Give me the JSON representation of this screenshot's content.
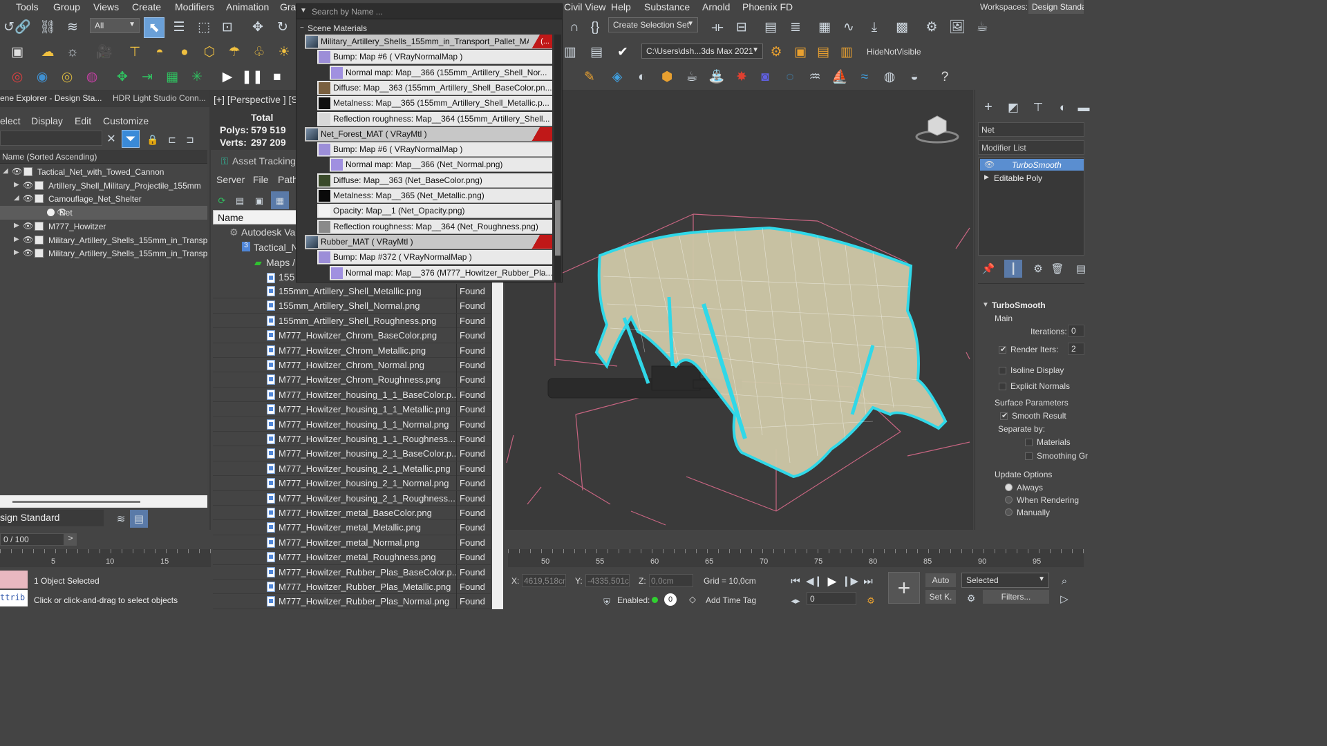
{
  "menu": [
    "Tools",
    "Group",
    "Views",
    "Create",
    "Modifiers",
    "Animation",
    "Gra",
    "Civil View",
    "Help",
    "Substance",
    "Arnold",
    "Phoenix FD"
  ],
  "workspaces_label": "Workspaces:",
  "workspaces_value": "Design Standa",
  "toolbar": {
    "filter_value": "All",
    "create_selection_set": "Create Selection Set",
    "path_value": "C:\\Users\\dsh...3ds Max 2021",
    "hide_not_visible": "HideNotVisible"
  },
  "scene_explorer": {
    "tab1": "ene Explorer - Design Sta...",
    "tab2": "HDR Light Studio Conn...",
    "menus": [
      "elect",
      "Display",
      "Edit",
      "Customize"
    ],
    "column_header": "Name (Sorted Ascending)",
    "items": [
      {
        "label": "Tactical_Net_with_Towed_Cannon",
        "indent": 0,
        "expander": "open"
      },
      {
        "label": "Artillery_Shell_Military_Projectile_155mm",
        "indent": 1,
        "expander": "closed"
      },
      {
        "label": "Camouflage_Net_Shelter",
        "indent": 1,
        "expander": "open"
      },
      {
        "label": "Net",
        "indent": 2,
        "expander": "none",
        "selected": true
      },
      {
        "label": "M777_Howitzer",
        "indent": 1,
        "expander": "closed"
      },
      {
        "label": "Military_Artillery_Shells_155mm_in_Transpor",
        "indent": 1,
        "expander": "closed"
      },
      {
        "label": "Military_Artillery_Shells_155mm_in_Transpor",
        "indent": 1,
        "expander": "closed"
      }
    ],
    "workspace_value": "sign Standard"
  },
  "viewport": {
    "label": "[+] [Perspective ] [S",
    "stats_title": "Total",
    "polys_label": "Polys:",
    "polys_value": "579 519",
    "verts_label": "Verts:",
    "verts_value": "297 209"
  },
  "asset_tracking": {
    "title": "Asset Tracking",
    "menus": [
      "Server",
      "File",
      "Path"
    ],
    "col_name": "Name",
    "tree": [
      "Autodesk Vau",
      "Tactical_N",
      "Maps /",
      "155"
    ],
    "files": [
      {
        "name": "155mm_Artillery_Shell_Metallic.png",
        "status": "Found"
      },
      {
        "name": "155mm_Artillery_Shell_Normal.png",
        "status": "Found"
      },
      {
        "name": "155mm_Artillery_Shell_Roughness.png",
        "status": "Found"
      },
      {
        "name": "M777_Howitzer_Chrom_BaseColor.png",
        "status": "Found"
      },
      {
        "name": "M777_Howitzer_Chrom_Metallic.png",
        "status": "Found"
      },
      {
        "name": "M777_Howitzer_Chrom_Normal.png",
        "status": "Found"
      },
      {
        "name": "M777_Howitzer_Chrom_Roughness.png",
        "status": "Found"
      },
      {
        "name": "M777_Howitzer_housing_1_1_BaseColor.p...",
        "status": "Found"
      },
      {
        "name": "M777_Howitzer_housing_1_1_Metallic.png",
        "status": "Found"
      },
      {
        "name": "M777_Howitzer_housing_1_1_Normal.png",
        "status": "Found"
      },
      {
        "name": "M777_Howitzer_housing_1_1_Roughness....",
        "status": "Found"
      },
      {
        "name": "M777_Howitzer_housing_2_1_BaseColor.p...",
        "status": "Found"
      },
      {
        "name": "M777_Howitzer_housing_2_1_Metallic.png",
        "status": "Found"
      },
      {
        "name": "M777_Howitzer_housing_2_1_Normal.png",
        "status": "Found"
      },
      {
        "name": "M777_Howitzer_housing_2_1_Roughness....",
        "status": "Found"
      },
      {
        "name": "M777_Howitzer_metal_BaseColor.png",
        "status": "Found"
      },
      {
        "name": "M777_Howitzer_metal_Metallic.png",
        "status": "Found"
      },
      {
        "name": "M777_Howitzer_metal_Normal.png",
        "status": "Found"
      },
      {
        "name": "M777_Howitzer_metal_Roughness.png",
        "status": "Found"
      },
      {
        "name": "M777_Howitzer_Rubber_Plas_BaseColor.p...",
        "status": "Found"
      },
      {
        "name": "M777_Howitzer_Rubber_Plas_Metallic.png",
        "status": "Found"
      },
      {
        "name": "M777_Howitzer_Rubber_Plas_Normal.png",
        "status": "Found"
      }
    ]
  },
  "material_popup": {
    "search_placeholder": "Search by Name ...",
    "section": "Scene Materials",
    "rows": [
      {
        "text": "Military_Artillery_Shells_155mm_in_Transport_Pallet_MAT",
        "indent": 0,
        "kind": "mat",
        "badge": "(..."
      },
      {
        "text": "Bump: Map #6  ( VRayNormalMap )",
        "indent": 1,
        "kind": "map",
        "swatch": "#9c8ed8"
      },
      {
        "text": "Normal map:  Map__366 (155mm_Artillery_Shell_Nor...",
        "indent": 2,
        "kind": "map",
        "swatch": "#a090e0"
      },
      {
        "text": "Diffuse:  Map__363  (155mm_Artillery_Shell_BaseColor.pn...",
        "indent": 1,
        "kind": "map",
        "swatch": "#7a6040"
      },
      {
        "text": "Metalness:  Map__365  (155mm_Artillery_Shell_Metallic.p...",
        "indent": 1,
        "kind": "map",
        "swatch": "#111111"
      },
      {
        "text": "Reflection roughness:  Map__364  (155mm_Artillery_Shell...",
        "indent": 1,
        "kind": "map",
        "swatch": "#d8d8d8"
      },
      {
        "text": "Net_Forest_MAT  ( VRayMtl )",
        "indent": 0,
        "kind": "mat",
        "badge": ""
      },
      {
        "text": "Bump: Map #6  ( VRayNormalMap )",
        "indent": 1,
        "kind": "map",
        "swatch": "#9c8ed8"
      },
      {
        "text": "Normal map:  Map__366 (Net_Normal.png)",
        "indent": 2,
        "kind": "map",
        "swatch": "#a090e0"
      },
      {
        "text": "Diffuse:  Map__363 (Net_BaseColor.png)",
        "indent": 1,
        "kind": "map",
        "swatch": "#3a4a2a"
      },
      {
        "text": "Metalness:  Map__365 (Net_Metallic.png)",
        "indent": 1,
        "kind": "map",
        "swatch": "#0a0a0a"
      },
      {
        "text": "Opacity:  Map__1 (Net_Opacity.png)",
        "indent": 1,
        "kind": "map",
        "swatch": "#f4f4f4"
      },
      {
        "text": "Reflection roughness:  Map__364 (Net_Roughness.png)",
        "indent": 1,
        "kind": "map",
        "swatch": "#8a8a8a"
      },
      {
        "text": "Rubber_MAT  ( VRayMtl )",
        "indent": 0,
        "kind": "mat",
        "badge": ""
      },
      {
        "text": "Bump: Map #372  ( VRayNormalMap )",
        "indent": 1,
        "kind": "map",
        "swatch": "#9c8ed8"
      },
      {
        "text": "Normal map:  Map__376  (M777_Howitzer_Rubber_Pla...",
        "indent": 2,
        "kind": "map",
        "swatch": "#a090e0"
      }
    ]
  },
  "command_panel": {
    "object_name": "Net",
    "modifier_list": "Modifier List",
    "stack": [
      "TurboSmooth",
      "Editable Poly"
    ],
    "rollout": "TurboSmooth",
    "main": "Main",
    "iterations_label": "Iterations:",
    "iterations_value": "0",
    "render_iters_label": "Render Iters:",
    "render_iters_value": "2",
    "isoline": "Isoline Display",
    "explicit_normals": "Explicit Normals",
    "surface_params": "Surface Parameters",
    "smooth_result": "Smooth Result",
    "separate_by": "Separate by:",
    "materials": "Materials",
    "smoothing_groups": "Smoothing Gr",
    "update_options": "Update Options",
    "always": "Always",
    "when_rendering": "When Rendering",
    "manually": "Manually"
  },
  "timeline": {
    "frame_value": "0 / 100",
    "ticks_left": [
      "5",
      "10",
      "15"
    ],
    "ticks_right": [
      "50",
      "55",
      "60",
      "65",
      "70",
      "75",
      "80",
      "85",
      "90",
      "95"
    ]
  },
  "status": {
    "selected": "1 Object Selected",
    "hint": "Click or click-and-drag to select objects",
    "maxscript": "ttrib",
    "x_label": "X:",
    "x_value": "4619,518cm",
    "y_label": "Y:",
    "y_value": "-4335,501c",
    "z_label": "Z:",
    "z_value": "0,0cm",
    "grid": "Grid = 10,0cm",
    "enabled": "Enabled:",
    "add_time_tag": "Add Time Tag",
    "auto": "Auto",
    "set_k": "Set K.",
    "selected_dd": "Selected",
    "filters": "Filters...",
    "frame_field": "0"
  }
}
